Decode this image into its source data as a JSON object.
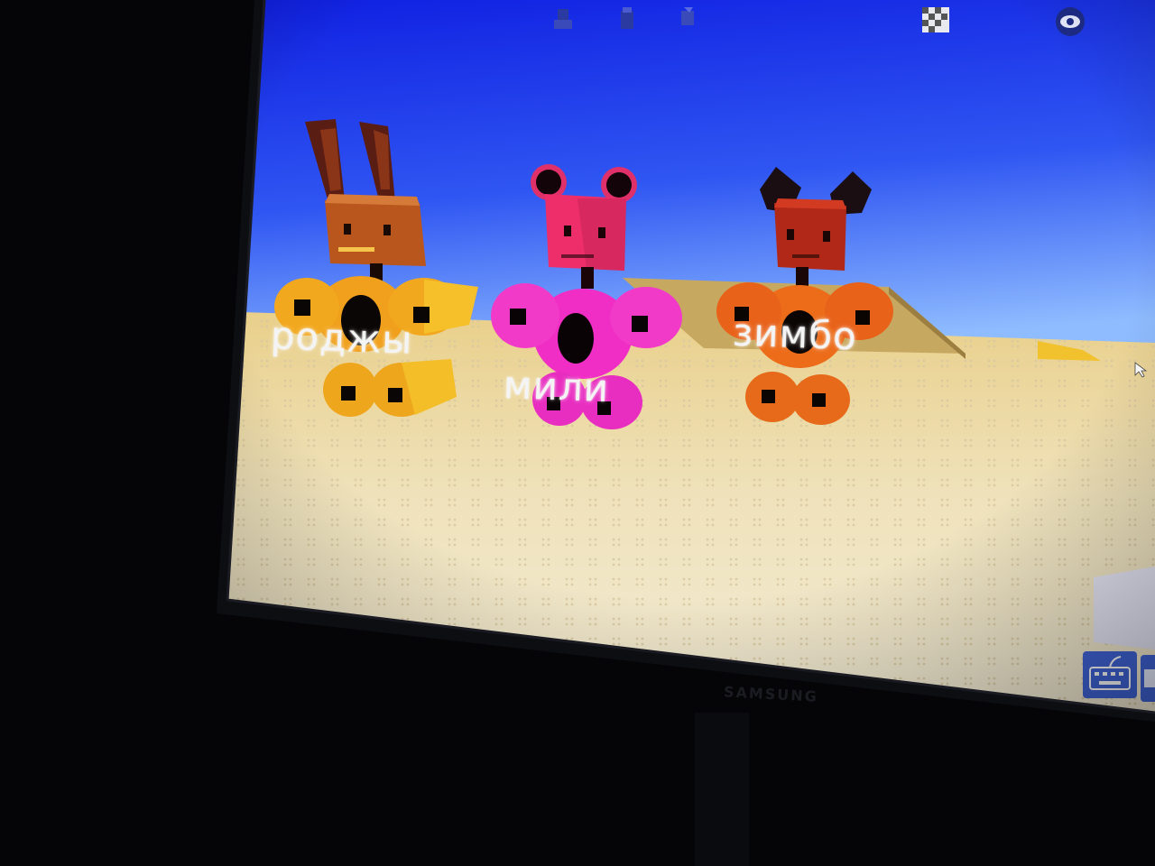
{
  "game": {
    "characters": [
      {
        "name": "роджы",
        "body_color": "#f0a21c",
        "head_color": "#b8551e",
        "ears": "long-bunny-ears"
      },
      {
        "name": "мили",
        "body_color": "#f030c8",
        "head_color": "#f0306a",
        "ears": "round-mouse-ears"
      },
      {
        "name": "зимбо",
        "body_color": "#ee6f1a",
        "head_color": "#b42a16",
        "ears": "pointed-dark-ears"
      }
    ],
    "toolbar_icons": [
      "figure-icon",
      "block-icon",
      "tool-icon",
      "checker-icon",
      "eye-icon"
    ],
    "controls": {
      "keyboard_button": "keyboard-icon",
      "second_button": "square-icon",
      "cursor": "mouse-cursor-icon"
    },
    "colors": {
      "sky_top": "#1526e6",
      "sky_bottom": "#7fb0ff",
      "floor": "#f1e6c4",
      "ui_button": "#3f63d6"
    }
  },
  "monitor": {
    "brand": "SAMSUNG"
  }
}
